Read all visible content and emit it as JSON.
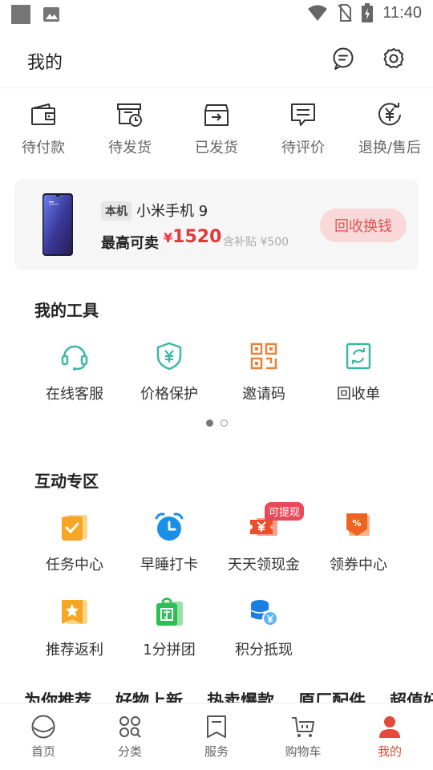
{
  "status_bar": {
    "time": "11:40"
  },
  "header": {
    "title": "我的"
  },
  "orders": [
    {
      "label": "待付款",
      "icon": "wallet-icon"
    },
    {
      "label": "待发货",
      "icon": "pending-shipment-icon"
    },
    {
      "label": "已发货",
      "icon": "shipped-box-icon"
    },
    {
      "label": "待评价",
      "icon": "review-icon"
    },
    {
      "label": "退换/售后",
      "icon": "refund-icon"
    }
  ],
  "promo": {
    "tag": "本机",
    "device": "小米手机 9",
    "max_label": "最高可卖",
    "currency": "¥",
    "price": "1520",
    "subsidy": "含补贴 ¥500",
    "button": "回收换钱"
  },
  "tools": {
    "title": "我的工具",
    "items": [
      {
        "label": "在线客服",
        "icon": "headset-icon"
      },
      {
        "label": "价格保护",
        "icon": "price-shield-icon"
      },
      {
        "label": "邀请码",
        "icon": "qr-code-icon"
      },
      {
        "label": "回收单",
        "icon": "recycle-icon"
      }
    ]
  },
  "interactive": {
    "title": "互动专区",
    "badge": "可提现",
    "items": [
      {
        "label": "任务中心",
        "icon": "task-icon"
      },
      {
        "label": "早睡打卡",
        "icon": "alarm-clock-icon"
      },
      {
        "label": "天天领现金",
        "icon": "cash-ticket-icon"
      },
      {
        "label": "领券中心",
        "icon": "coupon-icon"
      },
      {
        "label": "推荐返利",
        "icon": "star-icon"
      },
      {
        "label": "1分拼团",
        "icon": "group-buy-icon"
      },
      {
        "label": "积分抵现",
        "icon": "coins-icon"
      }
    ]
  },
  "recommend_tabs": [
    "为你推荐",
    "好物上新",
    "热卖爆款",
    "原厂配件",
    "超值好"
  ],
  "tabbar": [
    {
      "label": "首页",
      "icon": "home-icon"
    },
    {
      "label": "分类",
      "icon": "category-icon"
    },
    {
      "label": "服务",
      "icon": "service-icon"
    },
    {
      "label": "购物车",
      "icon": "cart-icon"
    },
    {
      "label": "我的",
      "icon": "profile-icon"
    }
  ],
  "colors": {
    "accent": "#e24a3b",
    "price": "#e23a3a",
    "teal": "#3bb8a4",
    "orange": "#f0a030"
  }
}
